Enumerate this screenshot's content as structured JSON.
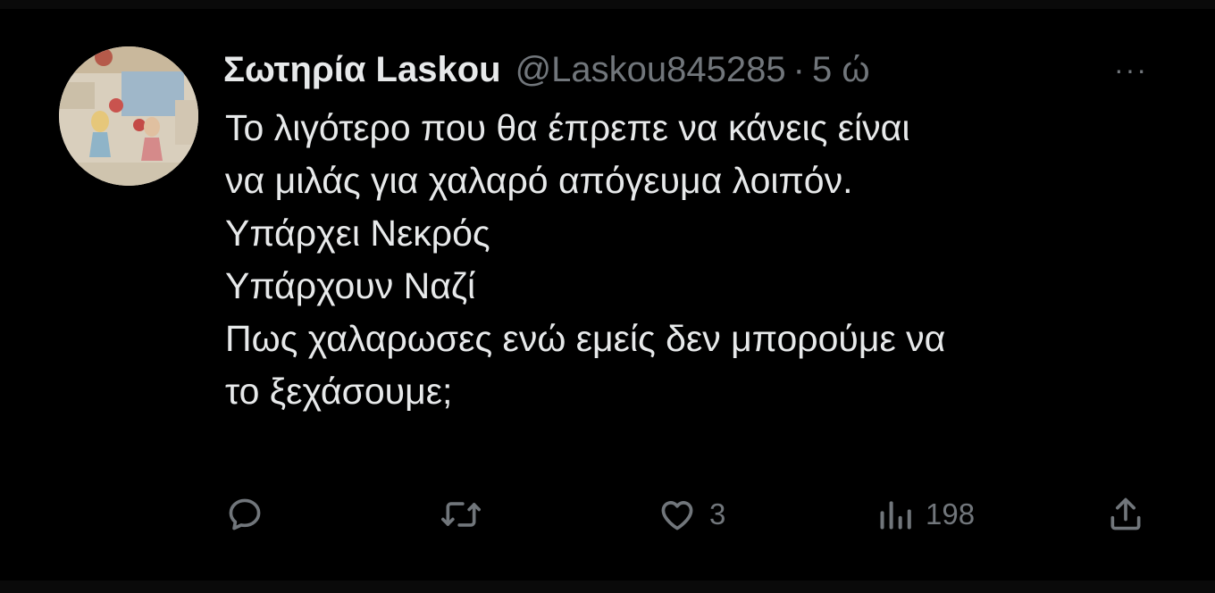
{
  "tweet": {
    "display_name": "Σωτηρία Laskou",
    "handle": "@Laskou845285",
    "separator": "·",
    "time": "5 ώ",
    "more_label": "···",
    "lines": [
      "Το λιγότερο που θα έπρεπε να κάνεις είναι",
      "να μιλάς για χαλαρό απόγευμα λοιπόν.",
      "Υπάρχει Νεκρός",
      "Υπάρχουν Ναζί",
      "Πως χαλαρωσες ενώ εμείς δεν μπορούμε να",
      "το ξεχάσουμε;"
    ]
  },
  "actions": {
    "reply": {
      "icon": "reply-icon"
    },
    "retweet": {
      "icon": "retweet-icon"
    },
    "like": {
      "icon": "heart-icon",
      "count": "3"
    },
    "views": {
      "icon": "views-icon",
      "count": "198"
    },
    "share": {
      "icon": "share-icon"
    }
  },
  "colors": {
    "background": "#000000",
    "text_primary": "#e7e9ea",
    "text_secondary": "#71767b"
  }
}
